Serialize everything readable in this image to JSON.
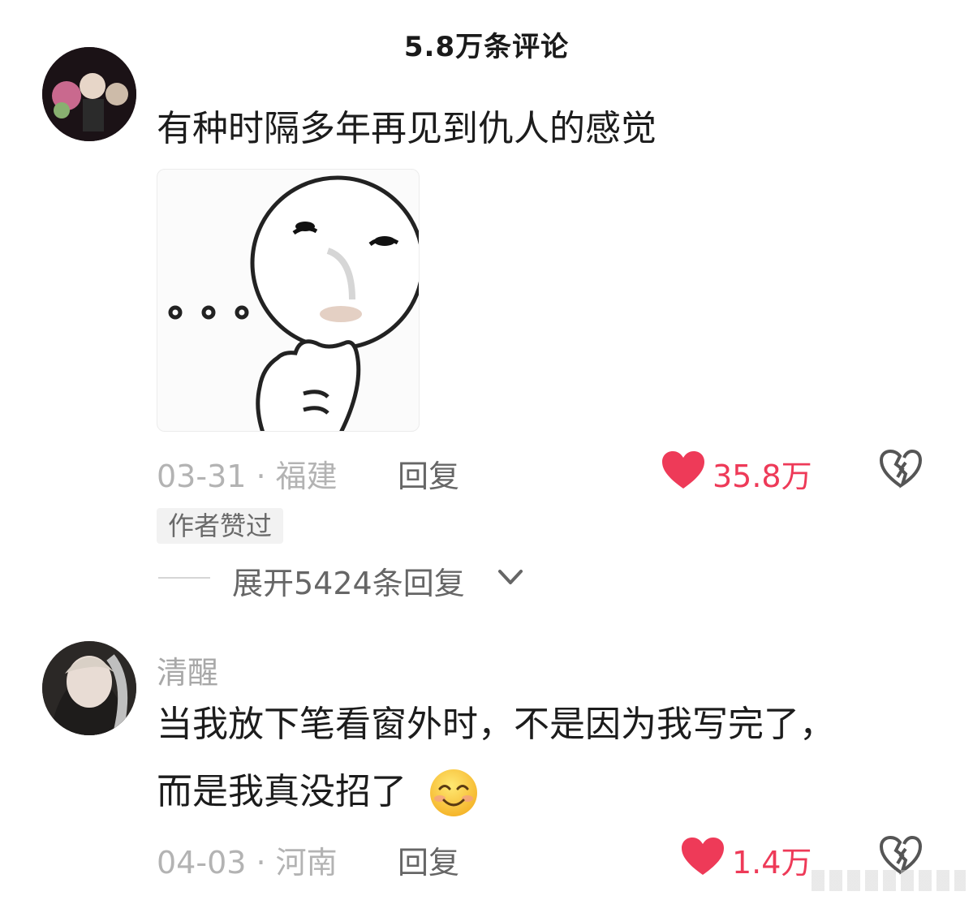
{
  "header": {
    "title": "5.8万条评论"
  },
  "comments": [
    {
      "username": "",
      "text": "有种时隔多年再见到仇人的感觉",
      "sticker": "thinking-face-sticker",
      "date": "03-31",
      "location": "福建",
      "reply_label": "回复",
      "likes": "35.8万",
      "author_liked_badge": "作者赞过",
      "expand_label": "展开5424条回复"
    },
    {
      "username": "清醒",
      "text_line1": "当我放下笔看窗外时，不是因为我写完了，",
      "text_line2": "而是我真没招了",
      "emoji": "smiling-face-emoji",
      "date": "04-03",
      "location": "河南",
      "reply_label": "回复",
      "likes": "1.4万"
    }
  ],
  "colors": {
    "like_red": "#ee3a58",
    "meta_gray": "#b3b3b3",
    "text_dark": "#1c1c1c"
  }
}
